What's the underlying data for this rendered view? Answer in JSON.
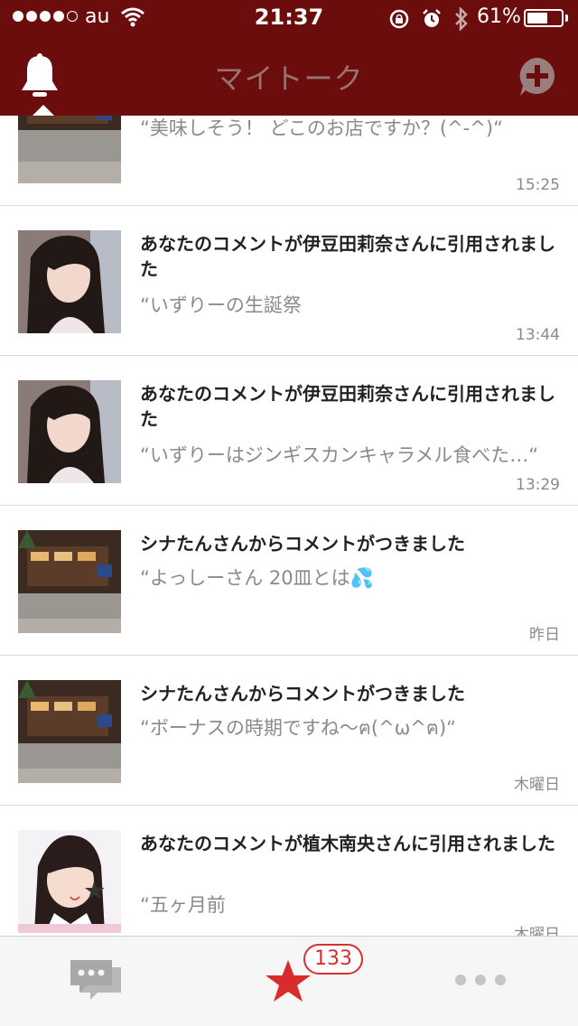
{
  "status_bar": {
    "carrier": "au",
    "time": "21:37",
    "battery_percent": "61%",
    "battery_level": 0.61,
    "signal_bars_filled": 4,
    "signal_bars_total": 5
  },
  "nav": {
    "title": "マイトーク",
    "left_icon": "bell-icon",
    "right_icon": "add-comment-icon"
  },
  "items": [
    {
      "title": "",
      "preview": "“美味しそう！ どこのお店ですか？(^-^)“",
      "time": "15:25",
      "thumb": "store-photo"
    },
    {
      "title": "あなたのコメントが伊豆田莉奈さんに引用されました",
      "preview": "“いずりーの生誕祭",
      "time": "13:44",
      "thumb": "person-photo"
    },
    {
      "title": "あなたのコメントが伊豆田莉奈さんに引用されました",
      "preview": "“いずりーはジンギスカンキャラメル食べた…“",
      "time": "13:29",
      "thumb": "person-photo"
    },
    {
      "title": "シナたんさんからコメントがつきました",
      "preview": "“よっしーさん 20皿とは💦",
      "time": "昨日",
      "thumb": "store-photo"
    },
    {
      "title": "シナたんさんからコメントがつきました",
      "preview": "“ボーナスの時期ですね〜ฅ(^ω^ฅ)“",
      "time": "木曜日",
      "thumb": "store-photo"
    },
    {
      "title": "あなたのコメントが植木南央さんに引用されました",
      "preview": "“五ヶ月前",
      "time": "木曜日",
      "thumb": "idol-photo"
    }
  ],
  "tabbar": {
    "badge_count": "133",
    "tabs": [
      "chat-icon",
      "star-icon",
      "more-icon"
    ]
  },
  "colors": {
    "header_bg": "#6b0d0d",
    "badge": "#d62f2f",
    "star": "#d92b2b"
  }
}
